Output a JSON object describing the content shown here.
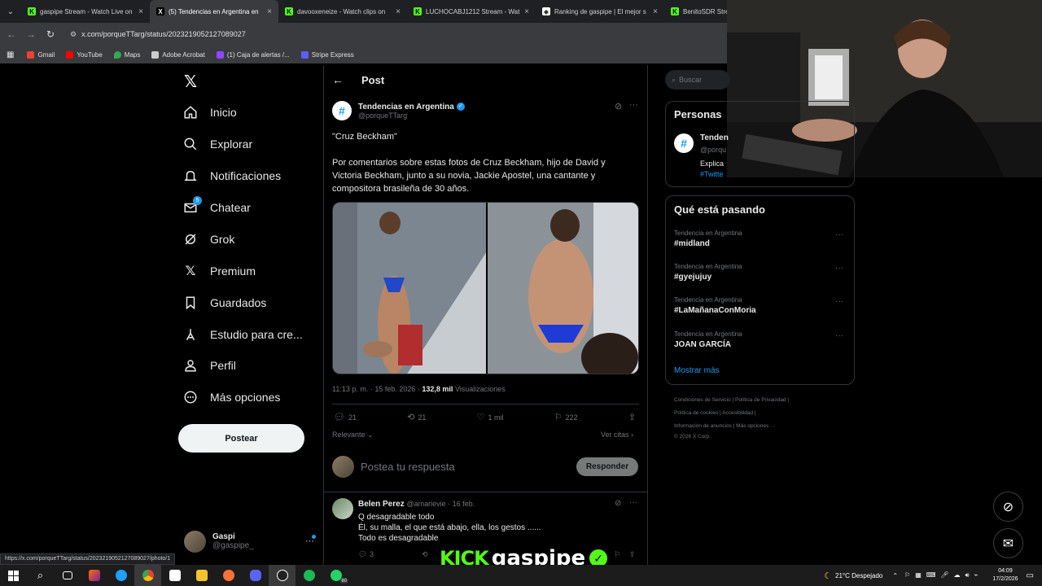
{
  "browser": {
    "tabs": [
      {
        "title": "gaspipe Stream - Watch Live on",
        "color": "#53fc18",
        "glyph": "K"
      },
      {
        "title": "(5) Tendencias en Argentina en",
        "color": "#000000",
        "glyph": "X"
      },
      {
        "title": "davooxeneize - Watch clips on",
        "color": "#53fc18",
        "glyph": "K"
      },
      {
        "title": "LUCHOCABJ1212 Stream - Wat",
        "color": "#53fc18",
        "glyph": "K"
      },
      {
        "title": "Ranking de gaspipe | El mejor s",
        "color": "#ffffff",
        "glyph": "◆"
      },
      {
        "title": "BenitoSDR Stre",
        "color": "#53fc18",
        "glyph": "K"
      }
    ],
    "url": "x.com/porqueTTarg/status/2023219052127089027",
    "bookmarks": [
      "Gmail",
      "YouTube",
      "Maps",
      "Adobe Acrobat",
      "(1) Caja de alertas /...",
      "Stripe Express"
    ],
    "status_url": "https://x.com/porqueTTarg/status/2023219052127089027/photo/1"
  },
  "nav": {
    "items": [
      "Inicio",
      "Explorar",
      "Notificaciones",
      "Chatear",
      "Grok",
      "Premium",
      "Guardados",
      "Estudio para cre...",
      "Perfil",
      "Más opciones"
    ],
    "chat_badge": "5",
    "post_button": "Postear",
    "account_name": "Gaspi",
    "account_handle": "@gaspipe_"
  },
  "post": {
    "header": "Post",
    "author": "Tendencias en Argentina",
    "handle": "@porqueTTarg",
    "title_line": "\"Cruz Beckham\"",
    "body": "Por comentarios sobre estas fotos de Cruz Beckham, hijo de David y Victoria Beckham, junto a su novia, Jackie Apostel, una cantante y compositora brasileña de 30 años.",
    "time": "11:13 p. m. · 15 feb. 2026 · ",
    "views": "132,8 mil",
    "views_label": " Visualizaciones",
    "replies": "21",
    "reposts": "21",
    "likes": "1 mil",
    "bookmarks": "222",
    "sort": "Relevante",
    "see_quotes": "Ver citas",
    "reply_placeholder": "Postea tu respuesta",
    "reply_button": "Responder"
  },
  "comment": {
    "name": "Belen Perez",
    "handle": "@amarievie · 16 feb.",
    "lines": [
      "Q desagradable todo",
      "Él, su malla, el que está abajo, ella, los gestos ......",
      "Todo es desagradable"
    ],
    "reply_count": "3"
  },
  "right": {
    "search_placeholder": "Buscar",
    "people_title": "Personas",
    "people_name": "Tenden",
    "people_handle": "@porqu",
    "people_desc": "Explica",
    "people_tag": "#Twitte",
    "trends_title": "Qué está pasando",
    "trends": [
      {
        "context": "Tendencia en Argentina",
        "name": "#midland"
      },
      {
        "context": "Tendencia en Argentina",
        "name": "#gyejujuy"
      },
      {
        "context": "Tendencia en Argentina",
        "name": "#LaMañanaConMoria"
      },
      {
        "context": "Tendencia en Argentina",
        "name": "JOAN GARCÍA"
      }
    ],
    "show_more": "Mostrar más",
    "footer": [
      "Condiciones de Servicio",
      "Política de Privacidad",
      "Política de cookies",
      "Accesibilidad",
      "Información de anuncios",
      "Más opciones ···",
      "© 2026 X Corp."
    ]
  },
  "overlay": {
    "kick": "KICK",
    "streamer": "gaspipe"
  },
  "taskbar": {
    "weather": "21°C  Despejado",
    "time": "04:09",
    "date": "17/2/2026",
    "whatsapp_badge": "60"
  },
  "colors": {
    "accent": "#1d9bf0",
    "kick": "#53fc18"
  }
}
